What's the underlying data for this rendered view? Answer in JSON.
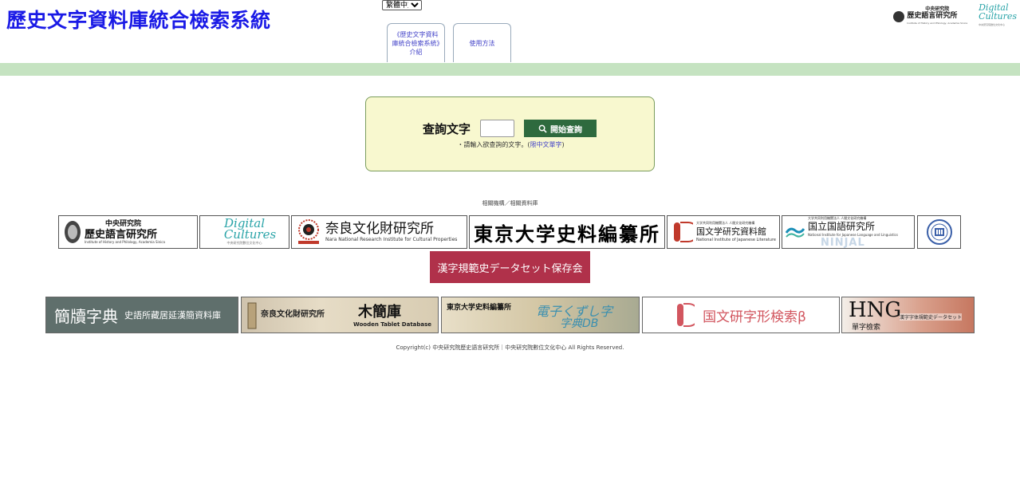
{
  "site": {
    "title": "歷史文字資料庫統合檢索系統",
    "language_selected": "繁體中文"
  },
  "nav": {
    "tabs": [
      {
        "label": "《歷史文字資料庫統合檢索系統》介紹"
      },
      {
        "label": "使用方法"
      }
    ]
  },
  "top_logos": {
    "ihp": {
      "line1": "中央研究院",
      "line2": "歷史語言研究所",
      "line3": "Institute of History and Philology, Academia Sinica"
    },
    "dc": {
      "line1": "Digital",
      "line2": "Cultures",
      "line3": "中央研究院數位文化中心"
    }
  },
  "search": {
    "label": "查詢文字",
    "input_value": "",
    "button_label": "開始查詢",
    "hint_prefix": "・請輸入欲查詢的文字。(",
    "hint_link": "限中文單字",
    "hint_suffix": ")"
  },
  "related": {
    "heading": "相關機構／相關資料庫",
    "ihp": {
      "line1": "中央研究院",
      "line2": "歷史語言研究所",
      "line3": "Institute of History and Philology, Academia Sinica"
    },
    "dc": {
      "line1": "Digital",
      "line2": "Cultures",
      "line3": "中央研究院數位文化中心"
    },
    "nara": {
      "name": "奈良文化財研究所",
      "sub": "Nara National Research Institute for Cultural Properties"
    },
    "hi": {
      "name": "東京大学史料編纂所"
    },
    "nijl": {
      "small": "大学共同利用機関法人 人間文化研究機構",
      "name": "国文学研究資料館",
      "sub": "National Institute of Japanese Literature"
    },
    "ninjal": {
      "small": "大学共同利用機関法人 人間文化研究機構",
      "name": "国立国語研究所",
      "sub": "National Institute for Japanese Language and Linguistics",
      "mark": "NINJAL"
    },
    "kanji_button": "漢字規範史データセット保存会"
  },
  "databases": {
    "jiandu": {
      "big": "簡牘字典",
      "small": "史語所藏居延漢簡資料庫"
    },
    "mokkan": {
      "org": "奈良文化財研究所",
      "title": "木簡庫",
      "sub": "Wooden Tablet Database"
    },
    "kuzushiji": {
      "org": "東京大学史料編纂所",
      "title1": "電子くずし字",
      "title2": "字典DB"
    },
    "nijl_search": {
      "title": "国文研字形検索β"
    },
    "hng": {
      "big": "HNG",
      "sub": "單字檢索",
      "side": "漢字字体規範史データセット"
    }
  },
  "footer": {
    "text": "Copyright(c) 中央研究院歷史語言研究所｜中央研究院數位文化中心 All Rights Reserved."
  },
  "colors": {
    "title_blue": "#1a1ae6",
    "green_bar": "#c5e3c1",
    "search_panel_bg": "#f8f8cf",
    "search_button_bg": "#2e6a3e",
    "kanji_button_bg": "#b0314a"
  }
}
